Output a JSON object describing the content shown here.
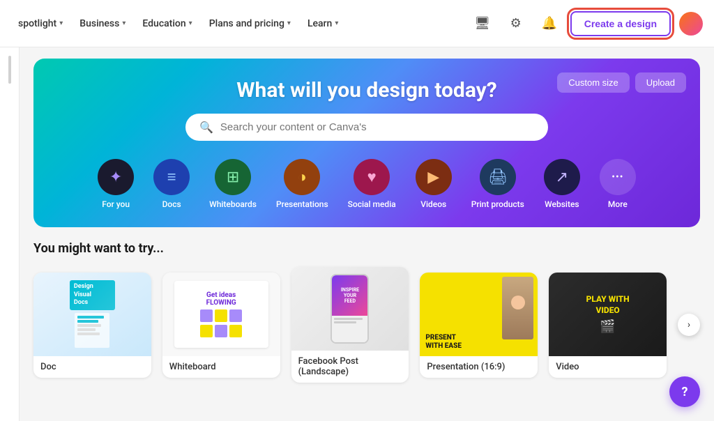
{
  "nav": {
    "spotlight_label": "spotlight",
    "business_label": "Business",
    "education_label": "Education",
    "plans_label": "Plans and pricing",
    "learn_label": "Learn",
    "create_label": "Create a design",
    "custom_size_label": "Custom size",
    "upload_label": "Upload"
  },
  "hero": {
    "title": "What will you design today?",
    "search_placeholder": "Search your content or Canva's"
  },
  "categories": [
    {
      "id": "foryou",
      "label": "For you",
      "icon": "✦",
      "class": "icon-foryou"
    },
    {
      "id": "docs",
      "label": "Docs",
      "icon": "≡",
      "class": "icon-docs"
    },
    {
      "id": "whiteboards",
      "label": "Whiteboards",
      "icon": "⊞",
      "class": "icon-whiteboards"
    },
    {
      "id": "presentations",
      "label": "Presentations",
      "icon": "◑",
      "class": "icon-presentations"
    },
    {
      "id": "social",
      "label": "Social media",
      "icon": "♥",
      "class": "icon-social"
    },
    {
      "id": "videos",
      "label": "Videos",
      "icon": "▶",
      "class": "icon-videos"
    },
    {
      "id": "print",
      "label": "Print products",
      "icon": "▨",
      "class": "icon-print"
    },
    {
      "id": "websites",
      "label": "Websites",
      "icon": "↗",
      "class": "icon-websites"
    },
    {
      "id": "more",
      "label": "More",
      "icon": "•••",
      "class": "icon-more"
    }
  ],
  "suggestions": {
    "title": "You might want to try...",
    "cards": [
      {
        "id": "doc",
        "label": "Doc"
      },
      {
        "id": "whiteboard",
        "label": "Whiteboard"
      },
      {
        "id": "facebook-post",
        "label": "Facebook Post (Landscape)"
      },
      {
        "id": "presentation",
        "label": "Presentation (16:9)"
      },
      {
        "id": "video",
        "label": "Video"
      }
    ]
  },
  "help_label": "?"
}
